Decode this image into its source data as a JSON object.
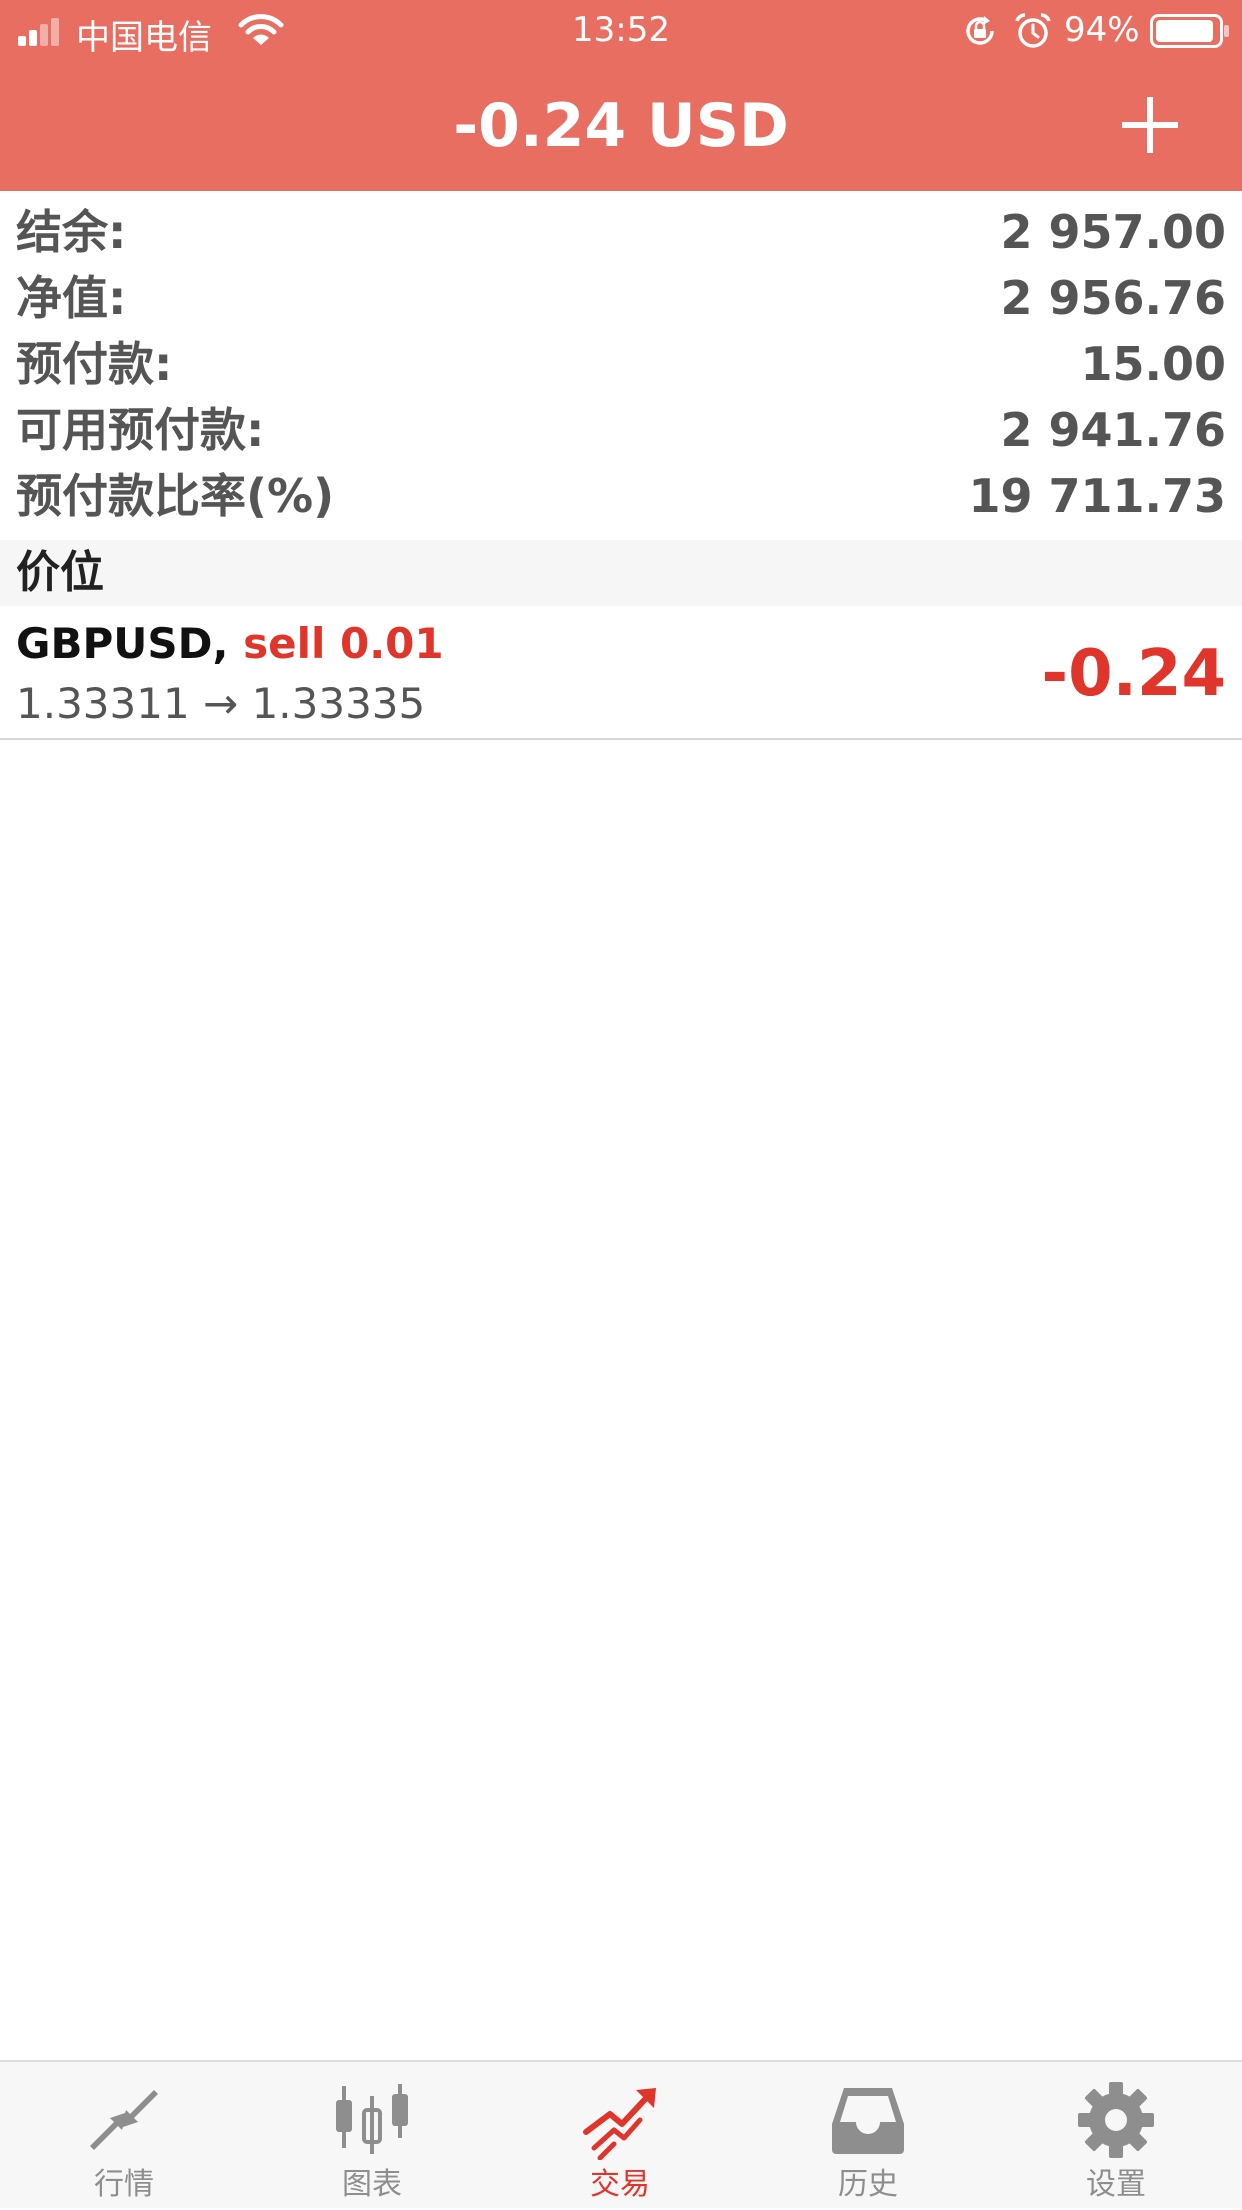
{
  "status_bar": {
    "carrier": "中国电信",
    "time": "13:52",
    "battery_percent": "94%",
    "battery_level": 0.94
  },
  "header": {
    "title": "-0.24 USD",
    "add_icon": "plus-icon"
  },
  "summary": [
    {
      "label": "结余:",
      "value": "2 957.00"
    },
    {
      "label": "净值:",
      "value": "2 956.76"
    },
    {
      "label": "预付款:",
      "value": "15.00"
    },
    {
      "label": "可用预付款:",
      "value": "2 941.76"
    },
    {
      "label": "预付款比率(%)",
      "value": "19 711.73"
    }
  ],
  "positions_section": {
    "title": "价位"
  },
  "positions": [
    {
      "symbol": "GBPUSD,",
      "side": "sell 0.01",
      "prices": "1.33311 → 1.33335",
      "profit": "-0.24"
    }
  ],
  "tabs": [
    {
      "label": "行情",
      "icon": "quotes-arrows-icon",
      "active": false
    },
    {
      "label": "图表",
      "icon": "candlestick-chart-icon",
      "active": false
    },
    {
      "label": "交易",
      "icon": "trade-trend-icon",
      "active": true
    },
    {
      "label": "历史",
      "icon": "inbox-tray-icon",
      "active": false
    },
    {
      "label": "设置",
      "icon": "gear-icon",
      "active": false
    }
  ],
  "colors": {
    "header_bg": "#e86e62",
    "loss_red": "#e0352b",
    "tab_inactive": "#8e8e8e",
    "text_gray": "#555555"
  }
}
